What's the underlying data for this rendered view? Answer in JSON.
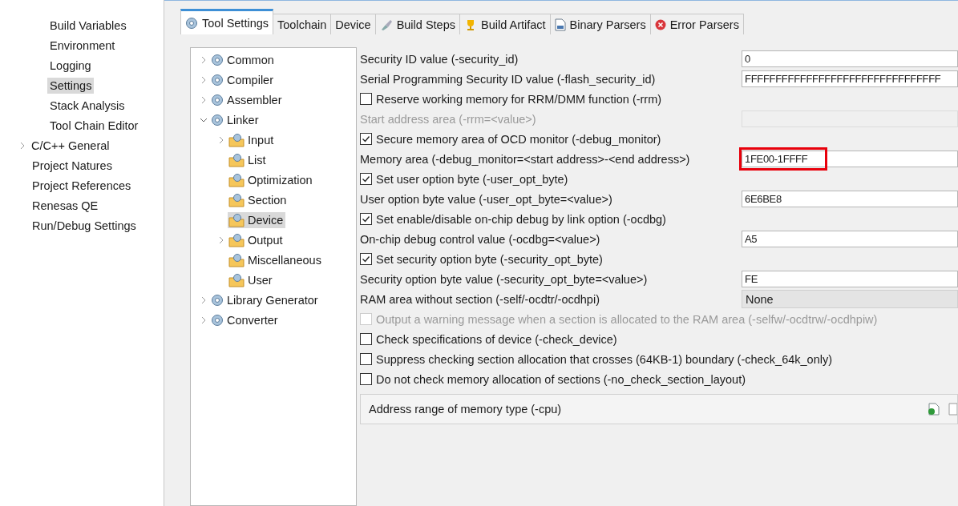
{
  "sidebar": {
    "nested_items": [
      {
        "label": "Build Variables",
        "selected": false
      },
      {
        "label": "Environment",
        "selected": false
      },
      {
        "label": "Logging",
        "selected": false
      },
      {
        "label": "Settings",
        "selected": true
      },
      {
        "label": "Stack Analysis",
        "selected": false
      },
      {
        "label": "Tool Chain Editor",
        "selected": false
      }
    ],
    "items": [
      {
        "label": "C/C++ General",
        "expanded": false
      },
      {
        "label": "Project Natures"
      },
      {
        "label": "Project References"
      },
      {
        "label": "Renesas QE"
      },
      {
        "label": "Run/Debug Settings"
      }
    ]
  },
  "tabs": [
    {
      "label": "Tool Settings",
      "selected": true
    },
    {
      "label": "Toolchain",
      "selected": false
    },
    {
      "label": "Device",
      "selected": false
    },
    {
      "label": "Build Steps",
      "selected": false
    },
    {
      "label": "Build Artifact",
      "selected": false
    },
    {
      "label": "Binary Parsers",
      "selected": false
    },
    {
      "label": "Error Parsers",
      "selected": false
    }
  ],
  "tree": [
    {
      "label": "Common",
      "expanded": false,
      "selected": false
    },
    {
      "label": "Compiler",
      "expanded": false,
      "selected": false
    },
    {
      "label": "Assembler",
      "expanded": false,
      "selected": false
    },
    {
      "label": "Linker",
      "expanded": true,
      "selected": false,
      "children": [
        {
          "label": "Input",
          "expanded": false,
          "selected": false
        },
        {
          "label": "List",
          "selected": false
        },
        {
          "label": "Optimization",
          "selected": false
        },
        {
          "label": "Section",
          "selected": false
        },
        {
          "label": "Device",
          "selected": true
        },
        {
          "label": "Output",
          "expanded": false,
          "selected": false
        },
        {
          "label": "Miscellaneous",
          "selected": false
        },
        {
          "label": "User",
          "selected": false
        }
      ]
    },
    {
      "label": "Library Generator",
      "expanded": false,
      "selected": false
    },
    {
      "label": "Converter",
      "expanded": false,
      "selected": false
    }
  ],
  "options": [
    {
      "kind": "text",
      "label": "Security ID value (-security_id)",
      "value": "0",
      "disabled": false,
      "highlighted": false
    },
    {
      "kind": "text",
      "label": "Serial Programming Security ID value (-flash_security_id)",
      "value": "FFFFFFFFFFFFFFFFFFFFFFFFFFFFFFFF",
      "disabled": false,
      "highlighted": false
    },
    {
      "kind": "check",
      "label": "Reserve working memory for RRM/DMM function (-rrm)",
      "checked": false,
      "disabled": false
    },
    {
      "kind": "text",
      "label": "Start address area (-rrm=<value>)",
      "disabled": true,
      "highlighted": false
    },
    {
      "kind": "check",
      "label": "Secure memory area of OCD monitor (-debug_monitor)",
      "checked": true,
      "disabled": false
    },
    {
      "kind": "text",
      "label": "Memory area (-debug_monitor=<start address>-<end address>)",
      "value": "1FE00-1FFFF",
      "disabled": false,
      "highlighted": true
    },
    {
      "kind": "check",
      "label": "Set user option byte (-user_opt_byte)",
      "checked": true,
      "disabled": false
    },
    {
      "kind": "text",
      "label": "User option byte value (-user_opt_byte=<value>)",
      "value": "6E6BE8",
      "disabled": false,
      "highlighted": false
    },
    {
      "kind": "check",
      "label": "Set enable/disable on-chip debug by link option (-ocdbg)",
      "checked": true,
      "disabled": false
    },
    {
      "kind": "text",
      "label": "On-chip debug control value (-ocdbg=<value>)",
      "value": "A5",
      "disabled": false,
      "highlighted": false
    },
    {
      "kind": "check",
      "label": "Set security option byte (-security_opt_byte)",
      "checked": true,
      "disabled": false
    },
    {
      "kind": "text",
      "label": "Security option byte value (-security_opt_byte=<value>)",
      "value": "FE",
      "disabled": false,
      "highlighted": false
    },
    {
      "kind": "combo",
      "label": "RAM area without section (-self/-ocdtr/-ocdhpi)",
      "value": "None"
    },
    {
      "kind": "check",
      "label": "Output a warning message when a section is allocated to the RAM area (-selfw/-ocdtrw/-ocdhpiw)",
      "checked": false,
      "disabled": true
    },
    {
      "kind": "check",
      "label": "Check specifications of device (-check_device)",
      "checked": false,
      "disabled": false
    },
    {
      "kind": "check",
      "label": "Suppress checking section allocation that crosses (64KB-1) boundary (-check_64k_only)",
      "checked": false,
      "disabled": false
    },
    {
      "kind": "check",
      "label": "Do not check memory allocation of sections (-no_check_section_layout)",
      "checked": false,
      "disabled": false
    },
    {
      "kind": "list",
      "label": "Address range of memory type (-cpu)"
    }
  ]
}
